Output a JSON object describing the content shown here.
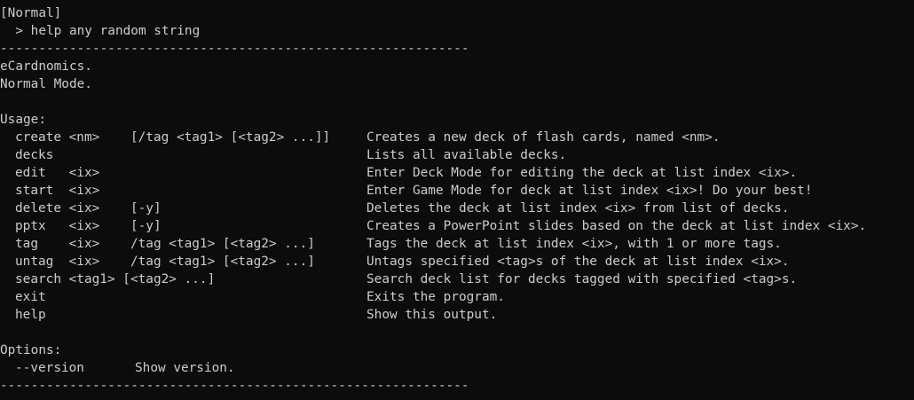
{
  "mode_tag": "[Normal]",
  "input_line": "  > help any random string",
  "separator": "-------------------------------------------------------------",
  "app_name": "eCardnomics.",
  "mode_line": "Normal Mode.",
  "usage_header": "Usage:",
  "commands": [
    {
      "cmd": "create <nm>    [/tag <tag1> [<tag2> ...]]",
      "desc": "Creates a new deck of flash cards, named <nm>."
    },
    {
      "cmd": "decks",
      "desc": "Lists all available decks."
    },
    {
      "cmd": "edit   <ix>",
      "desc": "Enter Deck Mode for editing the deck at list index <ix>."
    },
    {
      "cmd": "start  <ix>",
      "desc": "Enter Game Mode for deck at list index <ix>! Do your best!"
    },
    {
      "cmd": "delete <ix>    [-y]",
      "desc": "Deletes the deck at list index <ix> from list of decks."
    },
    {
      "cmd": "pptx   <ix>    [-y]",
      "desc": "Creates a PowerPoint slides based on the deck at list index <ix>."
    },
    {
      "cmd": "tag    <ix>    /tag <tag1> [<tag2> ...]",
      "desc": "Tags the deck at list index <ix>, with 1 or more tags."
    },
    {
      "cmd": "untag  <ix>    /tag <tag1> [<tag2> ...]",
      "desc": "Untags specified <tag>s of the deck at list index <ix>."
    },
    {
      "cmd": "search <tag1> [<tag2> ...]",
      "desc": "Search deck list for decks tagged with specified <tag>s."
    },
    {
      "cmd": "exit",
      "desc": "Exits the program."
    },
    {
      "cmd": "help",
      "desc": "Show this output."
    }
  ],
  "options_header": "Options:",
  "options": [
    {
      "opt": "--version",
      "desc": "Show version."
    }
  ]
}
